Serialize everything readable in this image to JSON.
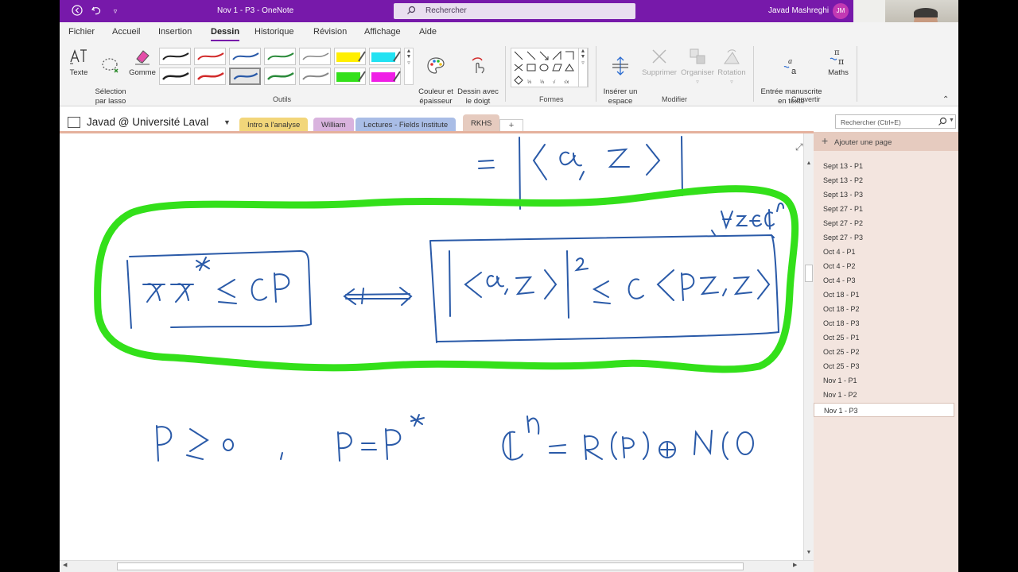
{
  "titlebar": {
    "title": "Nov 1 - P3  -  OneNote",
    "search_placeholder": "Rechercher",
    "user_name": "Javad Mashreghi",
    "user_initials": "JM"
  },
  "menu": [
    "Fichier",
    "Accueil",
    "Insertion",
    "Dessin",
    "Historique",
    "Révision",
    "Affichage",
    "Aide"
  ],
  "active_menu": "Dessin",
  "ribbon": {
    "texte": "Texte",
    "lasso": "Sélection\npar lasso",
    "gomme": "Gomme",
    "outils_label": "Outils",
    "couleur": "Couleur et\népaisseur",
    "dessin_doigt": "Dessin avec\nle doigt",
    "formes_label": "Formes",
    "inserer_espace": "Insérer un\nespace",
    "supprimer": "Supprimer",
    "organiser": "Organiser",
    "rotation": "Rotation",
    "modifier_label": "Modifier",
    "entree_manuscrite": "Entrée manuscrite\nen texte",
    "maths": "Maths",
    "convertir_label": "Convertir"
  },
  "notebook": {
    "name": "Javad @ Université Laval",
    "sections": [
      {
        "label": "Intro a l'analyse",
        "color": "#f2d67a"
      },
      {
        "label": "William",
        "color": "#d9b3de"
      },
      {
        "label": "Lectures - Fields Institute",
        "color": "#a9bde6"
      },
      {
        "label": "RKHS",
        "color": "#e6cbbf"
      }
    ],
    "add_tab": "+",
    "search_pages_placeholder": "Rechercher (Ctrl+E)"
  },
  "pages": {
    "add_page": "Ajouter une page",
    "items": [
      "Sept 13 - P1",
      "Sept 13 - P2",
      "Sept 13 - P3",
      "Sept 27 - P1",
      "Sept 27 - P2",
      "Sept 27 - P3",
      "Oct 4 - P1",
      "Oct 4 - P2",
      "Oct 4 - P3",
      "Oct 18 - P1",
      "Oct 18 - P2",
      "Oct 18 - P3",
      "Oct 25 - P1",
      "Oct 25 - P2",
      "Oct 25 - P3",
      "Nov 1 - P1",
      "Nov 1 - P2",
      "Nov 1 - P3"
    ],
    "active": "Nov 1 - P3"
  },
  "colors": {
    "titlebar": "#7719aa",
    "ink_blue": "#2a5aa8",
    "highlight_green": "#33e01a"
  }
}
